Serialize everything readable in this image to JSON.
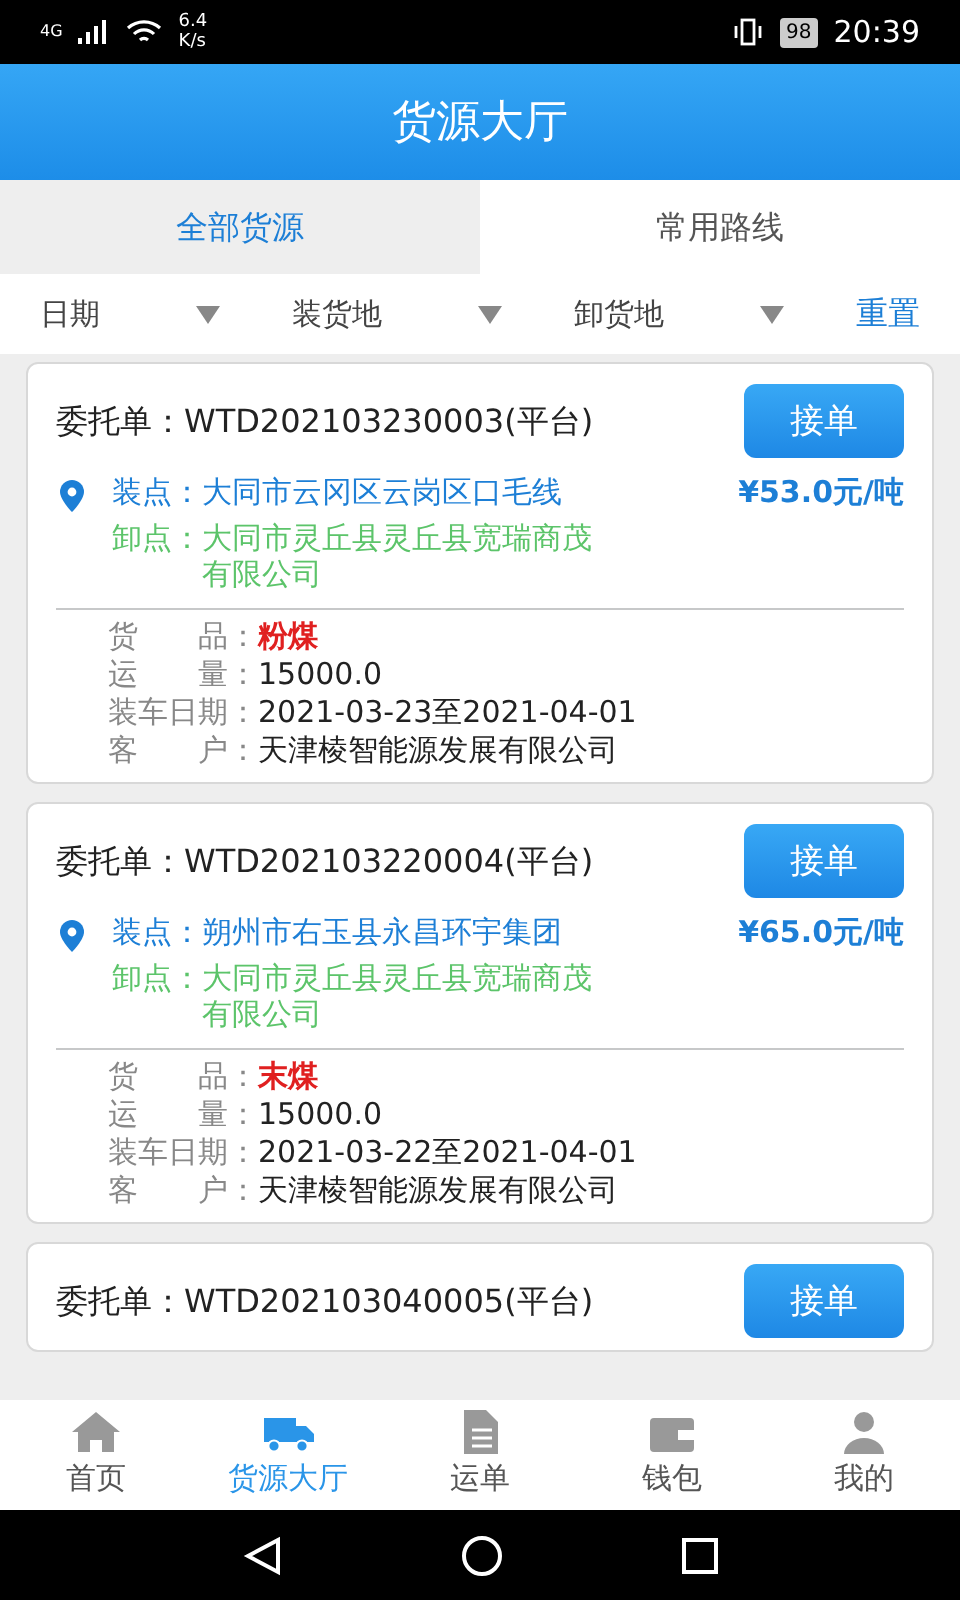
{
  "status_bar": {
    "network": "4G",
    "speed": "6.4 K/s",
    "battery": "98",
    "time": "20:39"
  },
  "header": {
    "title": "货源大厅"
  },
  "tabs": [
    {
      "label": "全部货源",
      "selected": true
    },
    {
      "label": "常用路线",
      "selected": false
    }
  ],
  "filters": [
    {
      "label": "日期"
    },
    {
      "label": "装货地"
    },
    {
      "label": "卸货地"
    }
  ],
  "reset": "重置",
  "orders": [
    {
      "title": "委托单：WTD202103230003(平台)",
      "button": "接单",
      "load_label": "装点：",
      "load": "大同市云冈区云岗区口毛线",
      "price": "¥53.0元/吨",
      "unload_label": "卸点：",
      "unload": "大同市灵丘县灵丘县宽瑞商茂有限公司",
      "details": [
        {
          "label": "货　　品：",
          "value": "粉煤",
          "kind": "highlight"
        },
        {
          "label": "运　　量：",
          "value": "15000.0",
          "kind": "plain"
        },
        {
          "label": "装车日期：",
          "value": "2021-03-23至2021-04-01",
          "kind": "plain"
        },
        {
          "label": "客　　户：",
          "value": "天津棱智能源发展有限公司",
          "kind": "plain"
        }
      ]
    },
    {
      "title": "委托单：WTD202103220004(平台)",
      "button": "接单",
      "load_label": "装点：",
      "load": "朔州市右玉县永昌环宇集团",
      "price": "¥65.0元/吨",
      "unload_label": "卸点：",
      "unload": "大同市灵丘县灵丘县宽瑞商茂有限公司",
      "details": [
        {
          "label": "货　　品：",
          "value": "末煤",
          "kind": "highlight"
        },
        {
          "label": "运　　量：",
          "value": "15000.0",
          "kind": "plain"
        },
        {
          "label": "装车日期：",
          "value": "2021-03-22至2021-04-01",
          "kind": "plain"
        },
        {
          "label": "客　　户：",
          "value": "天津棱智能源发展有限公司",
          "kind": "plain"
        }
      ]
    },
    {
      "title": "委托单：WTD202103040005(平台)",
      "button": "接单"
    }
  ],
  "bottom_nav": [
    {
      "label": "首页",
      "selected": false
    },
    {
      "label": "货源大厅",
      "selected": true
    },
    {
      "label": "运单",
      "selected": false
    },
    {
      "label": "钱包",
      "selected": false
    },
    {
      "label": "我的",
      "selected": false
    }
  ]
}
